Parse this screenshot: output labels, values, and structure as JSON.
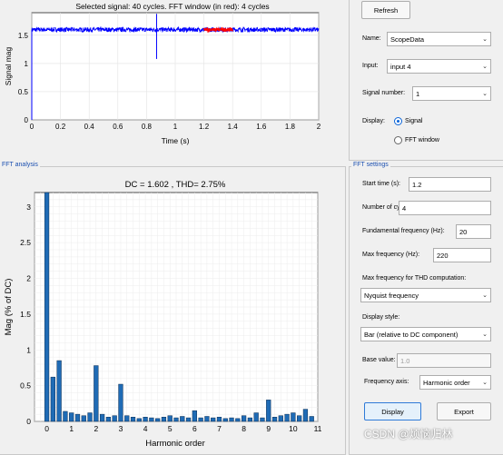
{
  "signal_plot": {
    "title": "Selected signal: 40 cycles. FFT window (in red): 4 cycles",
    "ylabel": "Signal mag",
    "xlabel": "Time (s)",
    "xticks": [
      "0",
      "0.2",
      "0.4",
      "0.6",
      "0.8",
      "1",
      "1.2",
      "1.4",
      "1.6",
      "1.8",
      "2"
    ],
    "yticks": [
      "0",
      "0.5",
      "1",
      "1.5"
    ]
  },
  "fft_section_title": "FFT analysis",
  "fft_plot": {
    "title": "DC = 1.602 , THD= 2.75%",
    "ylabel": "Mag (% of DC)",
    "xlabel": "Harmonic order",
    "xticks": [
      "0",
      "1",
      "2",
      "3",
      "4",
      "5",
      "6",
      "7",
      "8",
      "9",
      "10",
      "11"
    ],
    "yticks": [
      "0",
      "0.5",
      "1",
      "1.5",
      "2",
      "2.5",
      "3"
    ]
  },
  "signal_panel": {
    "refresh_label": "Refresh",
    "name_label": "Name:",
    "name_value": "ScopeData",
    "input_label": "Input:",
    "input_value": "input 4",
    "signal_number_label": "Signal number:",
    "signal_number_value": "1",
    "display_label": "Display:",
    "display_options": [
      "Signal",
      "FFT window"
    ],
    "display_selected": "Signal"
  },
  "fft_settings": {
    "title": "FFT settings",
    "start_time_label": "Start time (s):",
    "start_time_value": "1.2",
    "cycles_label": "Number of cycles:",
    "cycles_value": "4",
    "fund_freq_label": "Fundamental frequency (Hz):",
    "fund_freq_value": "20",
    "max_freq_label": "Max frequency (Hz):",
    "max_freq_value": "220",
    "thd_label": "Max frequency for THD computation:",
    "thd_value": "Nyquist frequency",
    "display_style_label": "Display style:",
    "display_style_value": "Bar (relative to DC component)",
    "base_value_label": "Base value:",
    "base_value_value": "1.0",
    "freq_axis_label": "Frequency axis:",
    "freq_axis_value": "Harmonic order",
    "display_button": "Display",
    "export_button": "Export"
  },
  "watermark": "CSDN @烦恼归林",
  "chart_data": [
    {
      "type": "line",
      "title": "Selected signal: 40 cycles. FFT window (in red): 4 cycles",
      "xlabel": "Time (s)",
      "ylabel": "Signal mag",
      "xlim": [
        0,
        2
      ],
      "ylim": [
        0,
        1.9
      ],
      "grid": true,
      "series": [
        {
          "color": "#0000ff",
          "level": 1.6,
          "noise": 0.04,
          "x_range": [
            0,
            2
          ]
        },
        {
          "color": "#ff0000",
          "level": 1.6,
          "noise": 0.03,
          "x_range": [
            1.2,
            1.4
          ]
        }
      ],
      "spikes": [
        {
          "x": 0.87,
          "ymin": 1.08,
          "ymax": 1.88
        }
      ]
    },
    {
      "type": "bar",
      "title": "DC = 1.602 , THD= 2.75%",
      "xlabel": "Harmonic order",
      "ylabel": "Mag (% of DC)",
      "xlim": [
        -0.5,
        11
      ],
      "ylim": [
        0,
        3.2
      ],
      "grid": true,
      "x": [
        0,
        0.25,
        0.5,
        0.75,
        1,
        1.25,
        1.5,
        1.75,
        2,
        2.25,
        2.5,
        2.75,
        3,
        3.25,
        3.5,
        3.75,
        4,
        4.25,
        4.5,
        4.75,
        5,
        5.25,
        5.5,
        5.75,
        6,
        6.25,
        6.5,
        6.75,
        7,
        7.25,
        7.5,
        7.75,
        8,
        8.25,
        8.5,
        8.75,
        9,
        9.25,
        9.5,
        9.75,
        10,
        10.25,
        10.5,
        10.75
      ],
      "values": [
        3.2,
        0.62,
        0.85,
        0.14,
        0.12,
        0.1,
        0.08,
        0.12,
        0.78,
        0.1,
        0.06,
        0.08,
        0.52,
        0.08,
        0.06,
        0.04,
        0.06,
        0.05,
        0.04,
        0.06,
        0.08,
        0.05,
        0.07,
        0.05,
        0.15,
        0.05,
        0.07,
        0.05,
        0.06,
        0.04,
        0.05,
        0.04,
        0.08,
        0.05,
        0.12,
        0.05,
        0.3,
        0.06,
        0.08,
        0.1,
        0.12,
        0.08,
        0.17,
        0.07
      ]
    }
  ]
}
